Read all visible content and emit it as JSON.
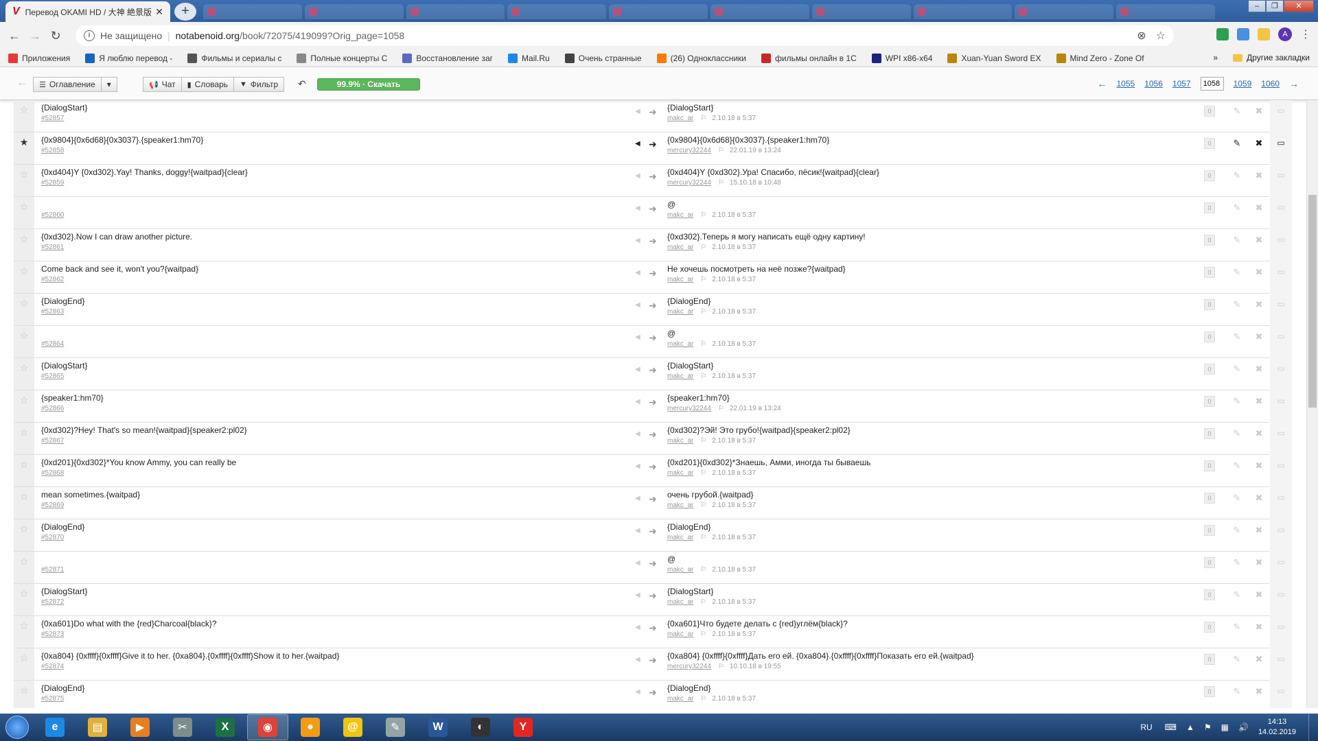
{
  "browser": {
    "tab_title": "Перевод OKAMI HD / 大神 絶景版",
    "tab_fav": "V",
    "insecure_label": "Не защищено",
    "url_host": "notabenoid.org",
    "url_path": "/book/72075/419099?Orig_page=1058",
    "avatar_letter": "A"
  },
  "bookmarks": [
    {
      "label": "Приложения",
      "color": "#e53935"
    },
    {
      "label": "Я люблю перевод -",
      "color": "#1565c0"
    },
    {
      "label": "Фильмы и сериалы с",
      "color": "#555555"
    },
    {
      "label": "Полные концерты С",
      "color": "#888888"
    },
    {
      "label": "Восстановление заг",
      "color": "#5c6bc0"
    },
    {
      "label": "Mail.Ru",
      "color": "#1e88e5"
    },
    {
      "label": "Очень странные",
      "color": "#444444"
    },
    {
      "label": "(26) Одноклассники",
      "color": "#f57c00"
    },
    {
      "label": "фильмы онлайн в 1С",
      "color": "#c62828"
    },
    {
      "label": "WPI x86-x64",
      "color": "#1a237e"
    },
    {
      "label": "Xuan-Yuan Sword EX",
      "color": "#b8860b"
    },
    {
      "label": "Mind Zero - Zone Of",
      "color": "#b8860b"
    }
  ],
  "bookmarks_more": "»",
  "other_bookmarks": "Другие закладки",
  "toolbar": {
    "toc": "Оглавление",
    "chat": "Чат",
    "dict": "Словарь",
    "filter": "Фильтр",
    "progress": "99.9% · Скачать",
    "progress_value": 99.9,
    "pages": [
      "1055",
      "1056",
      "1057"
    ],
    "current_page": "1058",
    "pages_after": [
      "1059",
      "1060"
    ],
    "prev_arrow": "←",
    "next_arrow": "→"
  },
  "rows": [
    {
      "orig": "{DialogStart}",
      "num": "#52857",
      "trans": "{DialogStart}",
      "user": "makc_ar",
      "date": "2.10.18 в 5:37",
      "active": false
    },
    {
      "orig": "{0x9804}{0x6d68}{0x3037}.{speaker1:hm70}",
      "num": "#52858",
      "trans": "{0x9804}{0x6d68}{0x3037}.{speaker1:hm70}",
      "user": "mercury32244",
      "date": "22.01.19 в 13:24",
      "active": true
    },
    {
      "orig": "{0xd404}Y {0xd302}.Yay! Thanks, doggy!{waitpad}{clear}",
      "num": "#52859",
      "trans": "{0xd404}Y {0xd302}.Ура! Спасибо, пёсик!{waitpad}{clear}",
      "user": "mercury32244",
      "date": "15.10.18 в 10:48",
      "active": false
    },
    {
      "orig": "",
      "num": "#52860",
      "trans": "@",
      "user": "makc_ar",
      "date": "2.10.18 в 5:37",
      "active": false
    },
    {
      "orig": "{0xd302}.Now I can draw another picture.",
      "num": "#52861",
      "trans": "{0xd302}.Теперь я могу написать ещё одну картину!",
      "user": "makc_ar",
      "date": "2.10.18 в 5:37",
      "active": false
    },
    {
      "orig": "Come back and see it, won't you?{waitpad}",
      "num": "#52862",
      "trans": "Не хочешь посмотреть на неё позже?{waitpad}",
      "user": "makc_ar",
      "date": "2.10.18 в 5:37",
      "active": false
    },
    {
      "orig": "{DialogEnd}",
      "num": "#52863",
      "trans": "{DialogEnd}",
      "user": "makc_ar",
      "date": "2.10.18 в 5:37",
      "active": false
    },
    {
      "orig": "",
      "num": "#52864",
      "trans": "@",
      "user": "makc_ar",
      "date": "2.10.18 в 5:37",
      "active": false
    },
    {
      "orig": "{DialogStart}",
      "num": "#52865",
      "trans": "{DialogStart}",
      "user": "makc_ar",
      "date": "2.10.18 в 5:37",
      "active": false
    },
    {
      "orig": "{speaker1:hm70}",
      "num": "#52866",
      "trans": "{speaker1:hm70}",
      "user": "mercury32244",
      "date": "22.01.19 в 13:24",
      "active": false
    },
    {
      "orig": "{0xd302}?Hey! That's so mean!{waitpad}{speaker2:pl02}",
      "num": "#52867",
      "trans": "{0xd302}?Эй! Это грубо!{waitpad}{speaker2:pl02}",
      "user": "makc_ar",
      "date": "2.10.18 в 5:37",
      "active": false
    },
    {
      "orig": "{0xd201}{0xd302}*You know Ammy, you can really be",
      "num": "#52868",
      "trans": "{0xd201}{0xd302}*Знаешь, Амми, иногда ты бываешь",
      "user": "makc_ar",
      "date": "2.10.18 в 5:37",
      "active": false
    },
    {
      "orig": "mean sometimes.{waitpad}",
      "num": "#52869",
      "trans": "очень грубой.{waitpad}",
      "user": "makc_ar",
      "date": "2.10.18 в 5:37",
      "active": false
    },
    {
      "orig": "{DialogEnd}",
      "num": "#52870",
      "trans": "{DialogEnd}",
      "user": "makc_ar",
      "date": "2.10.18 в 5:37",
      "active": false
    },
    {
      "orig": "",
      "num": "#52871",
      "trans": "@",
      "user": "makc_ar",
      "date": "2.10.18 в 5:37",
      "active": false
    },
    {
      "orig": "{DialogStart}",
      "num": "#52872",
      "trans": "{DialogStart}",
      "user": "makc_ar",
      "date": "2.10.18 в 5:37",
      "active": false
    },
    {
      "orig": "{0xa601}Do what with the {red}Charcoal{black}?",
      "num": "#52873",
      "trans": "{0xa601}Что будете делать с {red}углём{black}?",
      "user": "makc_ar",
      "date": "2.10.18 в 5:37",
      "active": false
    },
    {
      "orig": "{0xa804} {0xffff}{0xffff}Give it to her. {0xa804}.{0xffff}{0xffff}Show it to her.{waitpad}",
      "num": "#52874",
      "trans": "{0xa804} {0xffff}{0xffff}Дать его ей. {0xa804}.{0xffff}{0xffff}Показать его ей.{waitpad}",
      "user": "mercury32244",
      "date": "10.10.18 в 19:55",
      "active": false
    },
    {
      "orig": "{DialogEnd}",
      "num": "#52875",
      "trans": "{DialogEnd}",
      "user": "makc_ar",
      "date": "2.10.18 в 5:37",
      "active": false
    }
  ],
  "rating_value": "0",
  "taskbar": {
    "apps": [
      {
        "name": "internet-explorer",
        "label": "e",
        "color": "#1e88e5",
        "open": false
      },
      {
        "name": "explorer",
        "label": "▤",
        "color": "#e0b040",
        "open": false
      },
      {
        "name": "media-player",
        "label": "▶",
        "color": "#e67e22",
        "open": false
      },
      {
        "name": "snipping",
        "label": "✂",
        "color": "#7f8c8d",
        "open": false
      },
      {
        "name": "excel",
        "label": "X",
        "color": "#1d7044",
        "open": false
      },
      {
        "name": "chrome",
        "label": "◉",
        "color": "#db4437",
        "open": true
      },
      {
        "name": "app-orange",
        "label": "●",
        "color": "#f39c12",
        "open": false
      },
      {
        "name": "mail",
        "label": "@",
        "color": "#f1c40f",
        "open": false
      },
      {
        "name": "notes",
        "label": "✎",
        "color": "#95a5a6",
        "open": false
      },
      {
        "name": "word",
        "label": "W",
        "color": "#2b579a",
        "open": false
      },
      {
        "name": "eye-app",
        "label": "◐",
        "color": "#333333",
        "open": false
      },
      {
        "name": "yandex",
        "label": "Y",
        "color": "#e52620",
        "open": false
      }
    ],
    "lang": "RU",
    "time": "14:13",
    "date": "14.02.2019"
  }
}
